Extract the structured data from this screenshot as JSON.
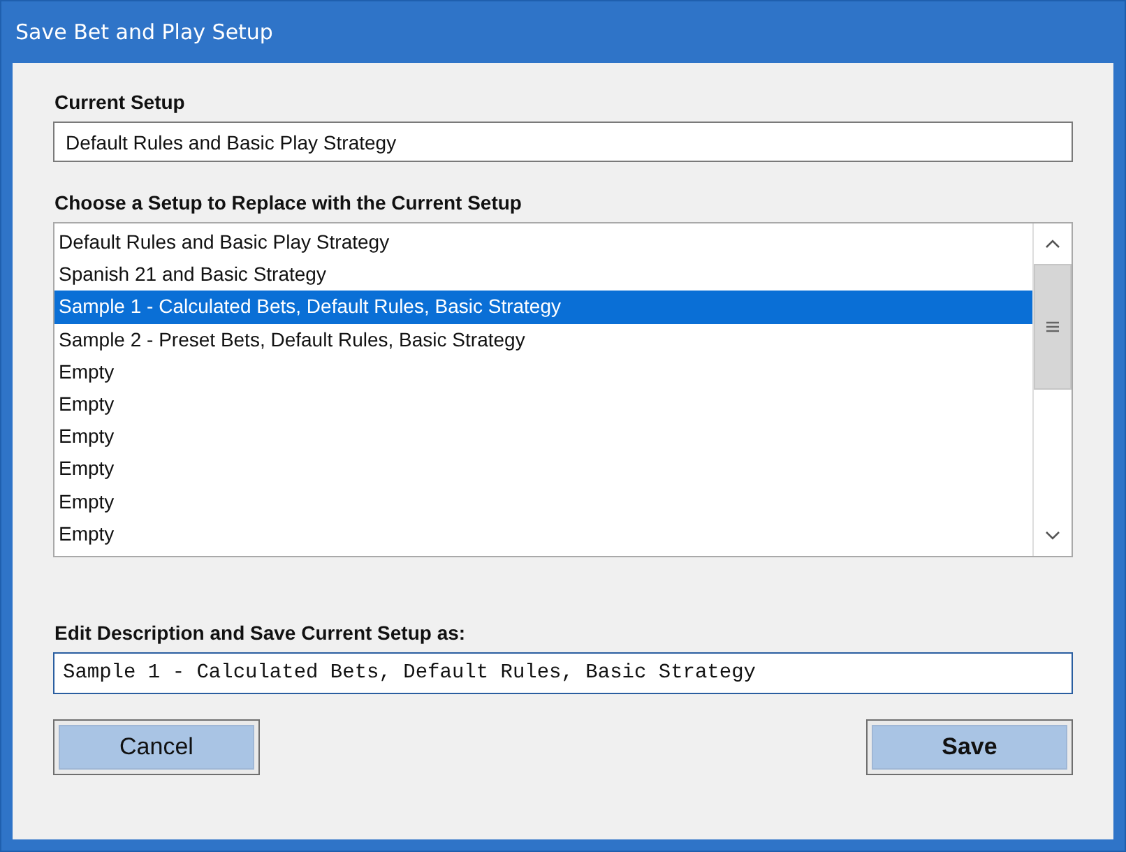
{
  "window": {
    "title": "Save Bet and Play Setup"
  },
  "current_setup": {
    "label": "Current Setup",
    "value": "Default Rules and Basic Play Strategy"
  },
  "setup_list": {
    "label": "Choose a Setup to Replace with the Current Setup",
    "items": [
      {
        "text": "Default Rules and Basic Play Strategy",
        "selected": false
      },
      {
        "text": "Spanish 21 and Basic Strategy",
        "selected": false
      },
      {
        "text": "Sample 1 - Calculated Bets, Default Rules, Basic Strategy",
        "selected": true
      },
      {
        "text": "Sample 2 - Preset Bets, Default Rules, Basic Strategy",
        "selected": false
      },
      {
        "text": "Empty",
        "selected": false
      },
      {
        "text": "Empty",
        "selected": false
      },
      {
        "text": "Empty",
        "selected": false
      },
      {
        "text": "Empty",
        "selected": false
      },
      {
        "text": "Empty",
        "selected": false
      },
      {
        "text": "Empty",
        "selected": false
      }
    ]
  },
  "description": {
    "label": "Edit Description and Save Current Setup as:",
    "value": "Sample 1 - Calculated Bets, Default Rules, Basic Strategy"
  },
  "buttons": [
    "Cancel",
    "Save"
  ]
}
